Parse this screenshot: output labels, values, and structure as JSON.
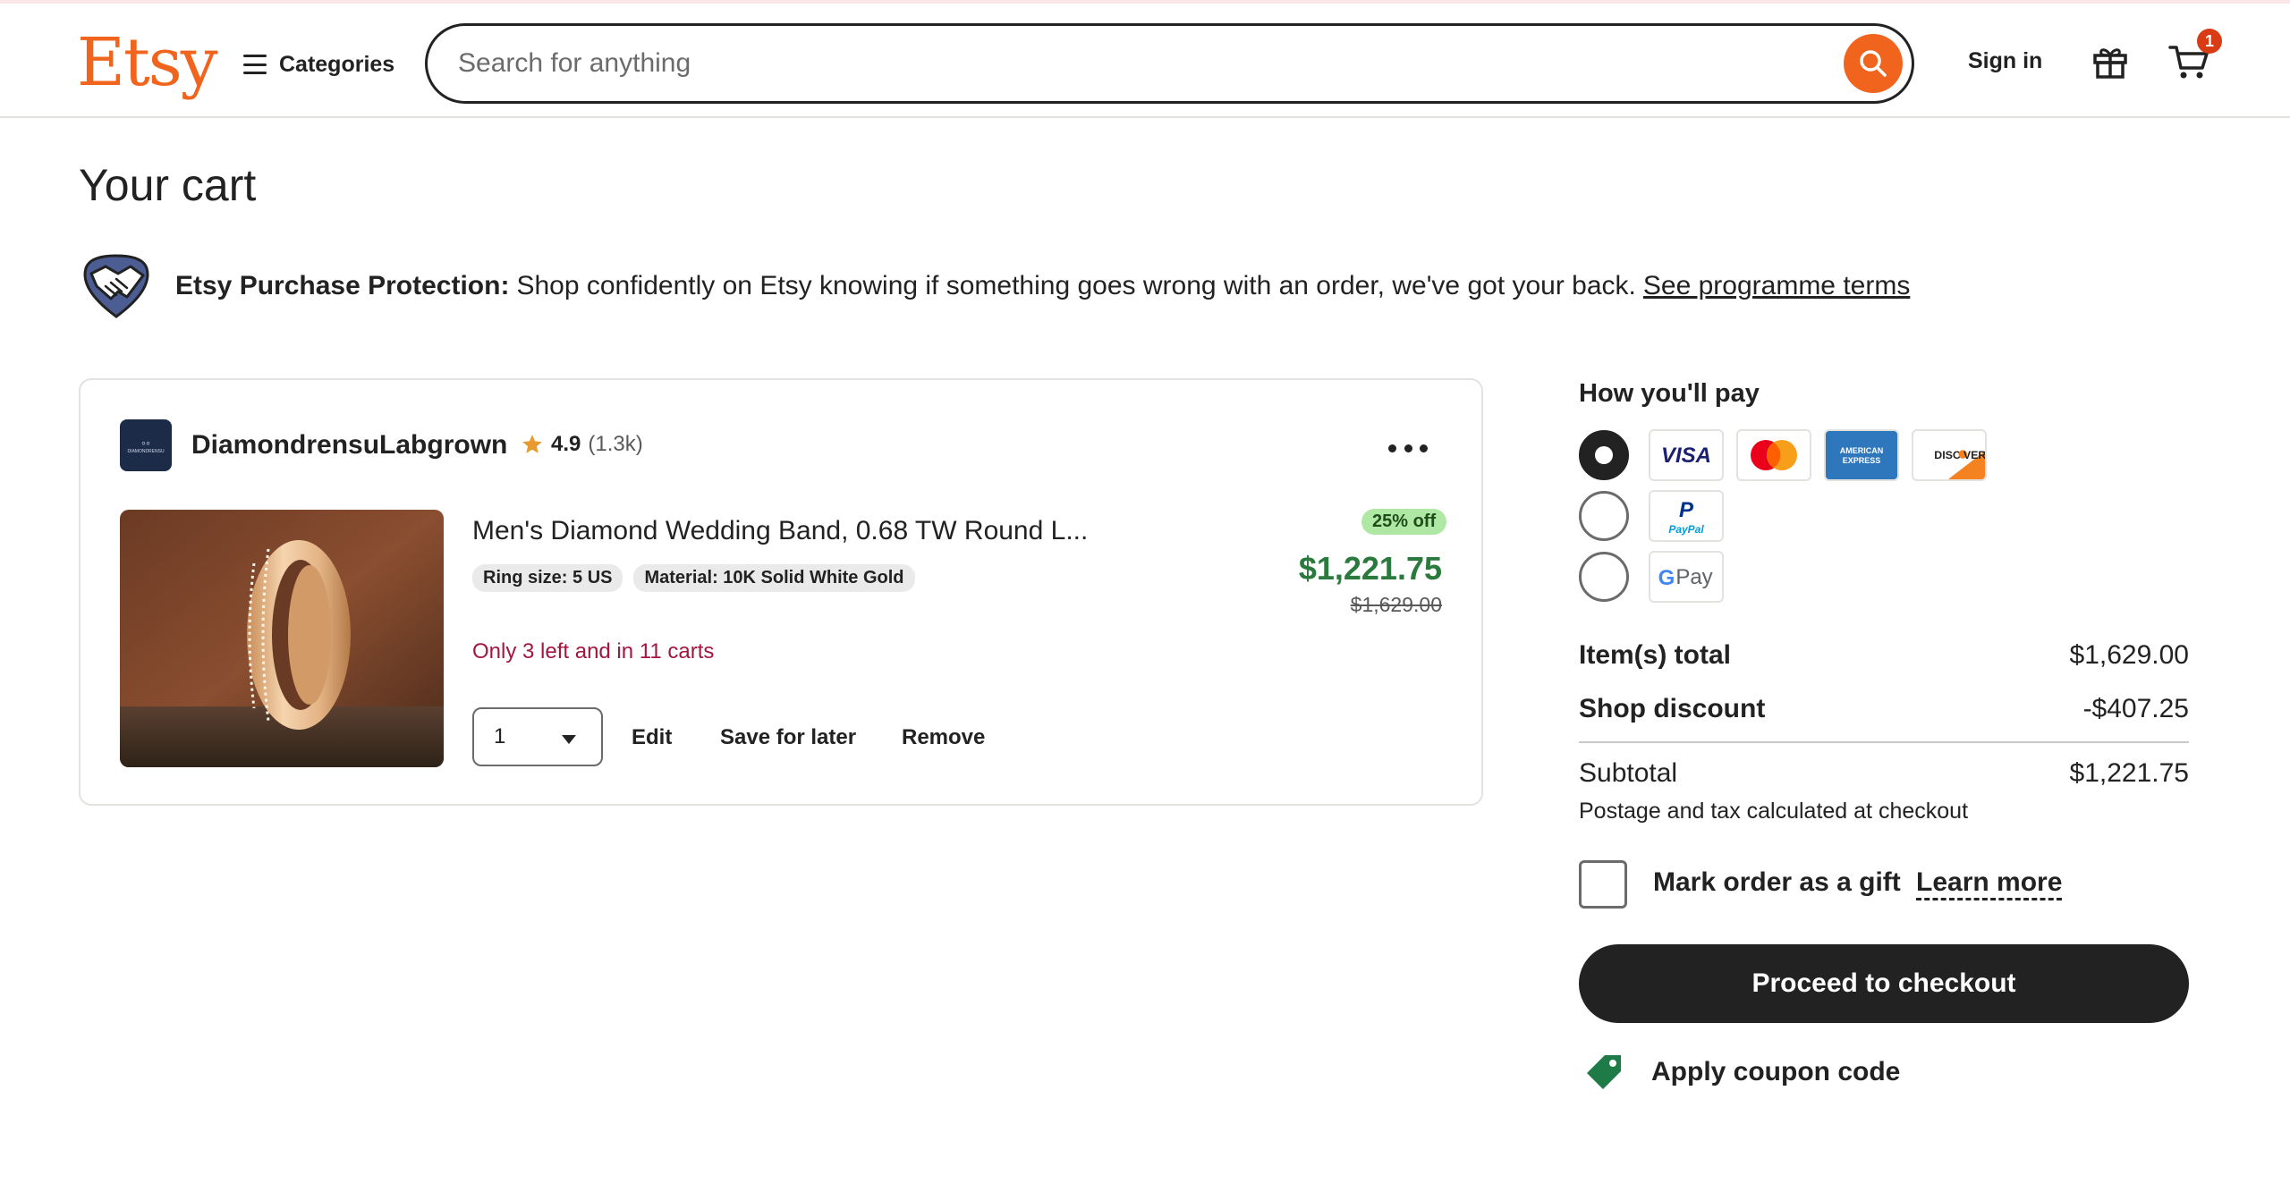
{
  "header": {
    "logo": "Etsy",
    "categories_label": "Categories",
    "search_placeholder": "Search for anything",
    "signin_label": "Sign in",
    "cart_count": "1",
    "icons": [
      "menu-icon",
      "search-icon",
      "gift-icon",
      "cart-icon"
    ]
  },
  "page": {
    "title": "Your cart"
  },
  "protection": {
    "heading": "Etsy Purchase Protection:",
    "text": "Shop confidently on Etsy knowing if something goes wrong with an order, we've got your back.",
    "link": "See programme terms"
  },
  "cart_item": {
    "shop_name": "DiamondrensuLabgrown",
    "shop_rating": "4.9",
    "shop_reviews": "(1.3k)",
    "title": "Men's Diamond Wedding Band, 0.68 TW Round L...",
    "variations": [
      "Ring size: 5 US",
      "Material: 10K Solid White Gold"
    ],
    "scarcity": "Only 3 left and in 11 carts",
    "quantity": "1",
    "actions": {
      "edit": "Edit",
      "save_for_later": "Save for later",
      "remove": "Remove"
    },
    "discount_badge": "25% off",
    "price": "$1,221.75",
    "original_price": "$1,629.00"
  },
  "summary": {
    "pay_title": "How you'll pay",
    "payment_methods": [
      {
        "name": "card",
        "selected": true,
        "logos": [
          "VISA",
          "Mastercard",
          "American Express",
          "DISCOVER"
        ]
      },
      {
        "name": "paypal",
        "selected": false,
        "logos": [
          "PayPal"
        ]
      },
      {
        "name": "google-pay",
        "selected": false,
        "logos": [
          "G Pay"
        ]
      }
    ],
    "items_total_label": "Item(s) total",
    "items_total": "$1,629.00",
    "shop_discount_label": "Shop discount",
    "shop_discount": "-$407.25",
    "subtotal_label": "Subtotal",
    "subtotal": "$1,221.75",
    "postage_note": "Postage and tax calculated at checkout",
    "gift_label": "Mark order as a gift",
    "learn_more": "Learn more",
    "checkout_label": "Proceed to checkout",
    "coupon_label": "Apply coupon code"
  },
  "colors": {
    "brand_orange": "#f1641e",
    "price_green": "#2b7a3d",
    "discount_pill": "#aee8a4",
    "scarcity_red": "#a3163f",
    "dark": "#222222"
  }
}
